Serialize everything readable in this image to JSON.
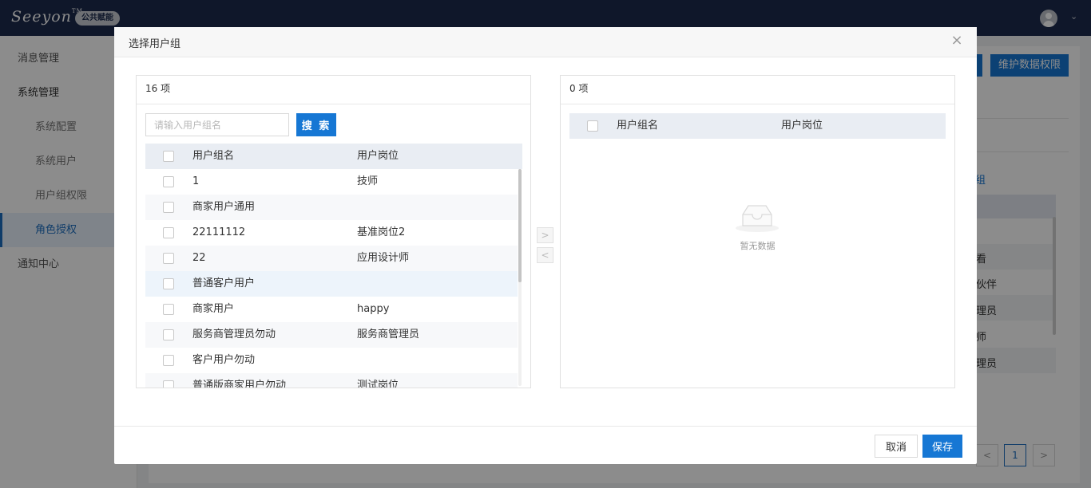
{
  "header": {
    "logo_text": "Seeyon",
    "logo_tm": "TM",
    "badge": "公共赋能"
  },
  "sidebar": {
    "items": [
      {
        "label": "消息管理"
      },
      {
        "label": "系统管理"
      },
      {
        "label": "系统配置"
      },
      {
        "label": "系统用户"
      },
      {
        "label": "用户组权限"
      },
      {
        "label": "角色授权"
      },
      {
        "label": "通知中心"
      }
    ]
  },
  "background": {
    "button_label": "维护数据权限",
    "link_fragment": "组",
    "row_fragments": [
      "看",
      "伙伴",
      "理员",
      "师",
      "理员"
    ],
    "pager": {
      "prev": "<",
      "current": "1",
      "next": ">"
    }
  },
  "dialog": {
    "title": "选择用户组",
    "close": "×",
    "left": {
      "count_label": "16 项",
      "search_placeholder": "请输入用户组名",
      "search_button": "搜 索",
      "columns": [
        "用户组名",
        "用户岗位"
      ],
      "rows": [
        {
          "name": "1",
          "post": "技师"
        },
        {
          "name": "商家用户通用",
          "post": ""
        },
        {
          "name": "22111112",
          "post": "基准岗位2"
        },
        {
          "name": "22",
          "post": "应用设计师"
        },
        {
          "name": "普通客户用户",
          "post": ""
        },
        {
          "name": "商家用户",
          "post": "happy"
        },
        {
          "name": "服务商管理员勿动",
          "post": "服务商管理员"
        },
        {
          "name": "客户用户勿动",
          "post": ""
        },
        {
          "name": "普通版商家用户勿动",
          "post": "测试岗位"
        }
      ]
    },
    "transfer": {
      "to_right": ">",
      "to_left": "<"
    },
    "right": {
      "count_label": "0 项",
      "columns": [
        "用户组名",
        "用户岗位"
      ],
      "empty_text": "暂无数据"
    },
    "footer": {
      "cancel": "取消",
      "save": "保存"
    }
  },
  "colors": {
    "header_bg": "#1c2b4d",
    "primary": "#1677d4",
    "table_header_bg": "#e9edf3",
    "highlight_row": "#edf4fb"
  }
}
